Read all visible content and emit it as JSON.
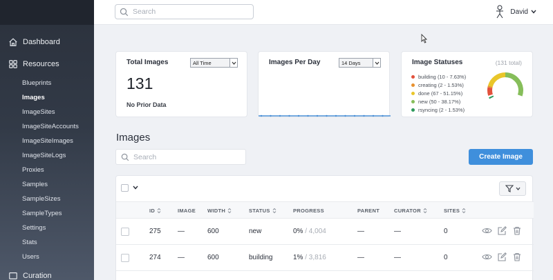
{
  "topbar": {
    "search_placeholder": "Search",
    "user_name": "David"
  },
  "sidebar": {
    "dashboard_label": "Dashboard",
    "resources_label": "Resources",
    "items": [
      {
        "label": "Blueprints",
        "active": false
      },
      {
        "label": "Images",
        "active": true
      },
      {
        "label": "ImageSites",
        "active": false
      },
      {
        "label": "ImageSiteAccounts",
        "active": false
      },
      {
        "label": "ImageSiteImages",
        "active": false
      },
      {
        "label": "ImageSiteLogs",
        "active": false
      },
      {
        "label": "Proxies",
        "active": false
      },
      {
        "label": "Samples",
        "active": false
      },
      {
        "label": "SampleSizes",
        "active": false
      },
      {
        "label": "SampleTypes",
        "active": false
      },
      {
        "label": "Settings",
        "active": false
      },
      {
        "label": "Stats",
        "active": false
      },
      {
        "label": "Users",
        "active": false
      }
    ],
    "curation_label": "Curation"
  },
  "cards": {
    "total": {
      "title": "Total Images",
      "range_selected": "All Time",
      "value": "131",
      "note": "No Prior Data"
    },
    "per_day": {
      "title": "Images Per Day",
      "range_selected": "14 Days"
    },
    "statuses": {
      "title": "Image Statuses",
      "total_label": "(131 total)",
      "legend": [
        {
          "label": "building (10 - 7.63%)",
          "color": "#e2513c"
        },
        {
          "label": "creating (2 - 1.53%)",
          "color": "#e8912f"
        },
        {
          "label": "done (67 - 51.15%)",
          "color": "#e9c62a"
        },
        {
          "label": "new (50 - 38.17%)",
          "color": "#86be5a"
        },
        {
          "label": "rsyncing (2 - 1.53%)",
          "color": "#2e9a5c"
        }
      ]
    }
  },
  "chart_data": {
    "type": "pie",
    "title": "Image Statuses",
    "categories": [
      "building",
      "creating",
      "done",
      "new",
      "rsyncing"
    ],
    "values": [
      10,
      2,
      67,
      50,
      2
    ],
    "colors": [
      "#e2513c",
      "#e8912f",
      "#e9c62a",
      "#86be5a",
      "#2e9a5c"
    ],
    "legend": "left"
  },
  "images": {
    "title": "Images",
    "search_placeholder": "Search",
    "create_label": "Create Image",
    "columns": [
      "ID",
      "IMAGE",
      "WIDTH",
      "STATUS",
      "PROGRESS",
      "PARENT",
      "CURATOR",
      "SITES"
    ],
    "rows": [
      {
        "id": "275",
        "image": "—",
        "width": "600",
        "status": "new",
        "progress": "0%",
        "progress_total": "/ 4,004",
        "parent": "—",
        "curator": "—",
        "sites": "0"
      },
      {
        "id": "274",
        "image": "—",
        "width": "600",
        "status": "building",
        "progress": "1%",
        "progress_total": "/ 3,816",
        "parent": "—",
        "curator": "—",
        "sites": "0"
      }
    ]
  }
}
